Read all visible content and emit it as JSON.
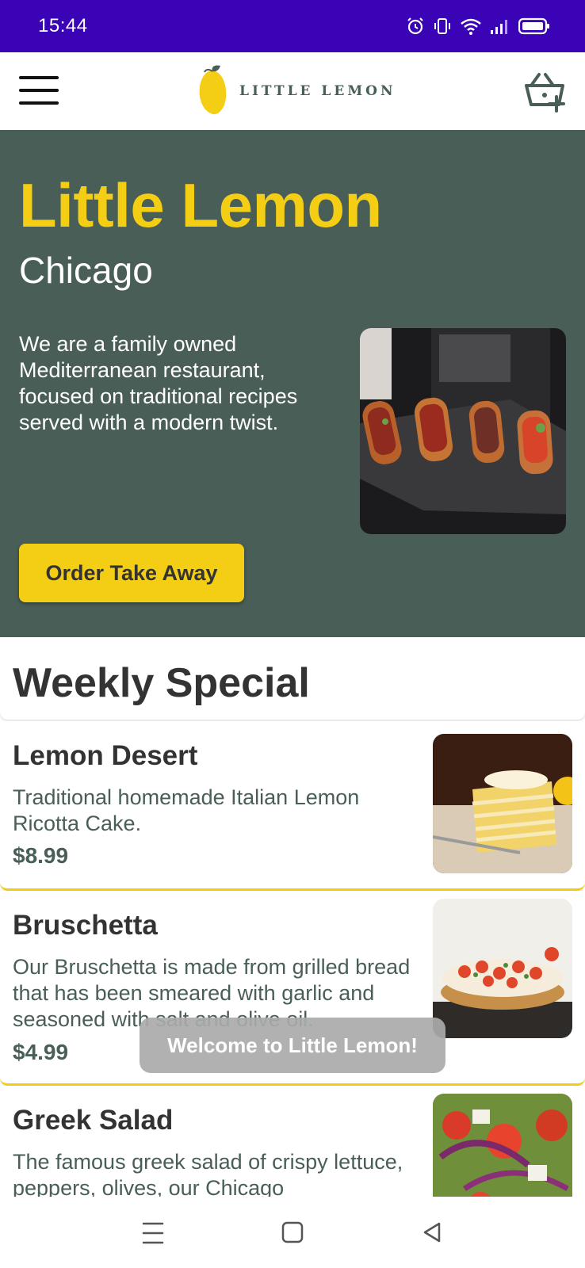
{
  "status_bar": {
    "time": "15:44",
    "icons": [
      "alarm-icon",
      "vibrate-icon",
      "wifi-icon",
      "signal-icon",
      "battery-icon"
    ]
  },
  "header": {
    "logo_text": "LITTLE LEMON",
    "icons": [
      "menu-icon",
      "lemon-logo-icon",
      "cart-add-icon"
    ]
  },
  "hero": {
    "title": "Little Lemon",
    "subtitle": "Chicago",
    "description": "We are a family owned Mediterranean restaurant, focused on traditional recipes served with a modern twist.",
    "button_label": "Order Take Away"
  },
  "weekly_special": {
    "title": "Weekly Special",
    "items": [
      {
        "name": "Lemon Desert",
        "description": "Traditional homemade Italian Lemon Ricotta Cake.",
        "price": "$8.99"
      },
      {
        "name": "Bruschetta",
        "description": "Our Bruschetta is made from grilled bread that has been smeared with garlic and seasoned with salt and olive oil.",
        "price": "$4.99"
      },
      {
        "name": "Greek Salad",
        "description": "The famous greek salad of crispy lettuce, peppers, olives, our Chicago",
        "price": ""
      }
    ]
  },
  "toast": {
    "message": "Welcome to Little Lemon!"
  },
  "nav_bar": {
    "icons": [
      "recent-apps-icon",
      "home-icon",
      "back-icon"
    ]
  },
  "colors": {
    "status_bar": "#3a03b5",
    "primary_green": "#495e57",
    "primary_yellow": "#f4ce14",
    "text_dark": "#333333"
  }
}
